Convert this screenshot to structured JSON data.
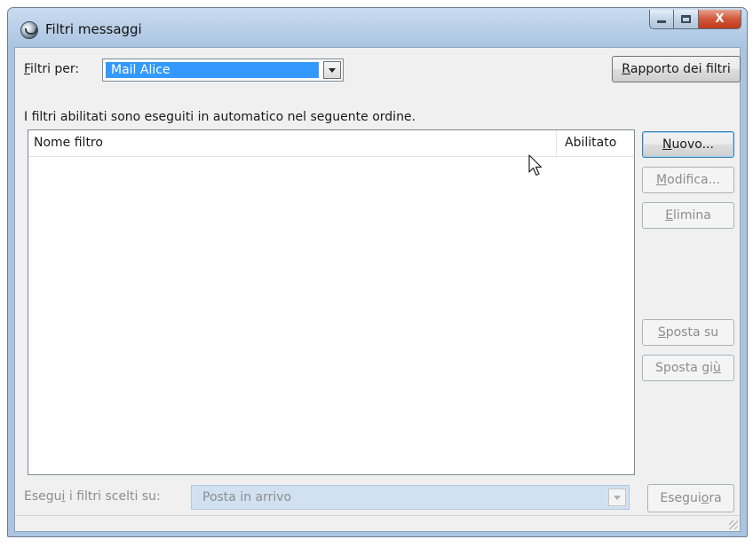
{
  "window": {
    "title": "Filtri messaggi",
    "icon": "thunderbird-icon",
    "close_glyph": "X"
  },
  "filters_for": {
    "label_accel": "F",
    "label_rest": "iltri per:",
    "selected": "Mail Alice"
  },
  "report_button": {
    "accel": "R",
    "rest": "apporto dei filtri"
  },
  "info_text": "I filtri abilitati sono eseguiti in automatico nel seguente ordine.",
  "list": {
    "columns": [
      "Nome filtro",
      "Abilitato"
    ],
    "rows": []
  },
  "buttons": {
    "nuovo": {
      "accel": "N",
      "rest": "uovo..."
    },
    "modifica": {
      "accel": "M",
      "rest": "odifica..."
    },
    "elimina": {
      "accel": "E",
      "rest": "limina"
    },
    "sposta_su": {
      "accel": "S",
      "rest": "posta su"
    },
    "sposta_giu": {
      "pre": "Sposta gi",
      "accel": "ù"
    }
  },
  "run_on": {
    "label_pre": "Esegu",
    "label_accel": "i",
    "label_rest": " i filtri scelti su:",
    "selected": "Posta in arrivo"
  },
  "run_now": {
    "pre": "Esegui ",
    "accel": "o",
    "rest": "ra"
  },
  "colors": {
    "selection": "#3399ff",
    "close_button": "#c9462a"
  }
}
